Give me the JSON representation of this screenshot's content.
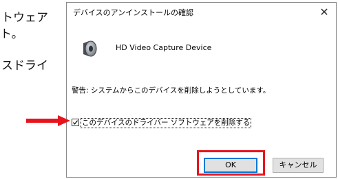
{
  "background_text": {
    "line1": "トウェア",
    "line2": "ト。",
    "line3": "スドライ"
  },
  "dialog": {
    "title": "デバイスのアンインストールの確認",
    "close_glyph": "✕",
    "device_name": "HD Video Capture Device",
    "warning": "警告: システムからこのデバイスを削除しようとしています。",
    "checkbox_label": "このデバイスのドライバー ソフトウェアを削除する",
    "checkbox_checked": true,
    "ok_label": "OK",
    "cancel_label": "キャンセル"
  },
  "annotations": {
    "arrow_color": "#e8141d",
    "highlight_color": "#e8141d"
  },
  "icons": {
    "device": "speaker-icon",
    "close": "close-icon",
    "check": "checkmark-icon"
  }
}
